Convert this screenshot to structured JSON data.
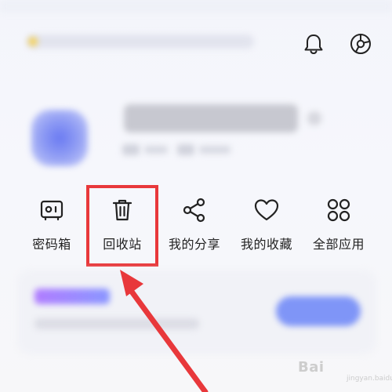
{
  "header": {
    "icons": [
      {
        "name": "bell-icon"
      },
      {
        "name": "settings-icon"
      }
    ]
  },
  "quick_actions": [
    {
      "id": "vault",
      "label": "密码箱",
      "icon": "safe-icon"
    },
    {
      "id": "recycle",
      "label": "回收站",
      "icon": "trash-icon",
      "highlighted": true
    },
    {
      "id": "share",
      "label": "我的分享",
      "icon": "share-icon"
    },
    {
      "id": "favorites",
      "label": "我的收藏",
      "icon": "heart-icon"
    },
    {
      "id": "apps",
      "label": "全部应用",
      "icon": "apps-grid-icon"
    }
  ],
  "annotation": {
    "highlight_color": "#e8383b",
    "arrow_color": "#e8383b"
  },
  "watermark": {
    "text": "Bai",
    "sub": "jingyan.baidu.com"
  }
}
